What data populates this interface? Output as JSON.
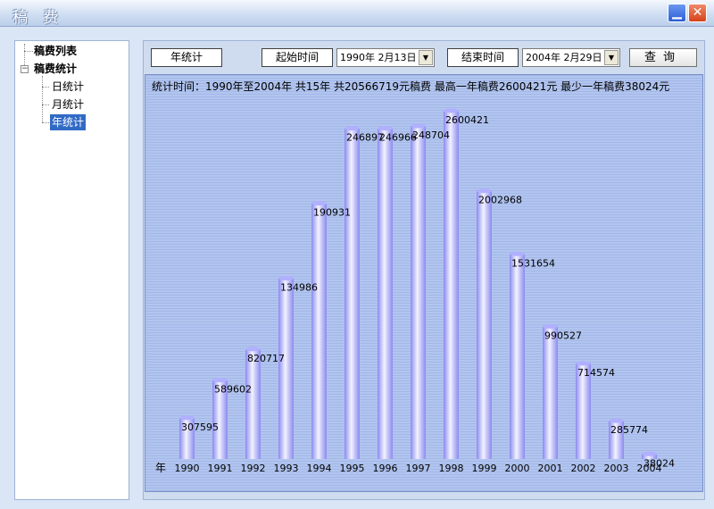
{
  "window": {
    "title": "稿 费"
  },
  "tree": {
    "items": [
      {
        "label": "稿费列表"
      },
      {
        "label": "稿费统计"
      },
      {
        "label": "日统计"
      },
      {
        "label": "月统计"
      },
      {
        "label": "年统计"
      }
    ]
  },
  "toolbar": {
    "mode_label": "年统计",
    "start_label": "起始时间",
    "start_value": "1990年 2月13日",
    "end_label": "结束时间",
    "end_value": "2004年 2月29日",
    "query_label": "查询"
  },
  "summary": "统计时间：1990年至2004年   共15年   共20566719元稿费   最高一年稿费2600421元   最少一年稿费38024元",
  "colors": {
    "bar_light": "#f2f2ff",
    "bar_dark": "#8a8af0",
    "bar_top": "#b0b0ff"
  },
  "chart_data": {
    "type": "bar",
    "x_unit_label": "年",
    "categories": [
      "1990",
      "1991",
      "1992",
      "1993",
      "1994",
      "1995",
      "1996",
      "1997",
      "1998",
      "1999",
      "2000",
      "2001",
      "2002",
      "2003",
      "2004"
    ],
    "values": [
      307595,
      589602,
      820717,
      1349860,
      1909310,
      2468970,
      2469660,
      2487040,
      2600421,
      2002968,
      1531654,
      990527,
      714574,
      285774,
      38024
    ],
    "data_labels": [
      "307595",
      "589602",
      "820717",
      "134986",
      "190931",
      "246897",
      "246966",
      "248704",
      "2600421",
      "2002968",
      "1531654",
      "990527",
      "714574",
      "285774",
      "38024"
    ],
    "ylim": [
      0,
      2600421
    ]
  }
}
